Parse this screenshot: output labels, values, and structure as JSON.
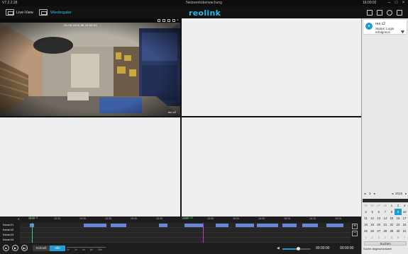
{
  "titlebar": {
    "version": "V7.2.2.28",
    "title": "Netzwerküberwachung",
    "clock": "16:00:02"
  },
  "toolbar": {
    "live_label": "Live-View",
    "playback_label": "Wiedergabe",
    "logo": "reolink"
  },
  "camera": {
    "osd": "04-05-2019 Mi 16:00:04",
    "name": "reo c2"
  },
  "device_panel": {
    "device_name": "reo c2",
    "status": "Status: Login erfolgreich",
    "icon": "camera-icon"
  },
  "calendar": {
    "month": "3",
    "year": "2019",
    "weekday_headers": [
      "",
      "",
      "",
      "",
      "",
      "",
      ""
    ],
    "weeks": [
      [
        "25",
        "26",
        "27",
        "28",
        "1",
        "2",
        "3"
      ],
      [
        "4",
        "5",
        "6",
        "7",
        "8",
        "9",
        "10"
      ],
      [
        "11",
        "12",
        "13",
        "14",
        "15",
        "16",
        "17"
      ],
      [
        "18",
        "19",
        "20",
        "21",
        "22",
        "23",
        "24"
      ],
      [
        "25",
        "26",
        "27",
        "28",
        "29",
        "30",
        "31"
      ],
      [
        "1",
        "2",
        "3",
        "4",
        "5",
        "6",
        "7"
      ]
    ],
    "selected_day": "9",
    "search_label": "Suchen",
    "status_message": "Suche abgeschlossen!"
  },
  "timeline": {
    "ruler_labels": [
      "15:20",
      "15:25",
      "15:30",
      "15:35",
      "15:40",
      "15:45",
      "15:50",
      "15:55",
      "16:00",
      "16:05",
      "16:10",
      "16:15",
      "16:20"
    ],
    "cursor_top": "15:20:11",
    "cursor_marker": "15:53:06",
    "cameras": [
      "Kanal-01",
      "Kanal-02",
      "Kanal-03",
      "Kanal-04"
    ],
    "record_color": "#6a86d9"
  },
  "controls": {
    "stop_label": "■",
    "play_label": "▶",
    "next_label": "▶|",
    "seg_left": "Schnell",
    "seg_right": "Alle",
    "speed_labels": [
      "1x",
      "2x",
      "4x",
      "8x",
      "16x"
    ],
    "volume_percent": 55,
    "time_start": "00:00:00",
    "time_end": "00:00:00"
  },
  "colors": {
    "accent": "#1f9bd6",
    "logo": "#2fb5e8",
    "record": "#6a86d9",
    "marker": "#3ccf6b"
  }
}
